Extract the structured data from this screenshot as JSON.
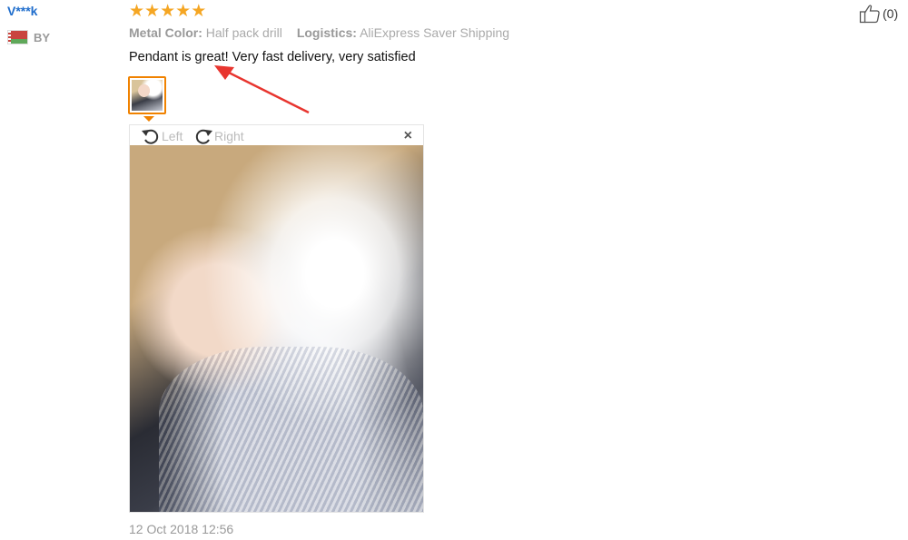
{
  "reviewer": {
    "name": "V***k",
    "country_code": "BY",
    "flag": "belarus-flag-icon"
  },
  "rating": {
    "stars": 5,
    "color": "#f5a623"
  },
  "attributes": {
    "metal_color_label": "Metal Color:",
    "metal_color_value": "Half pack drill",
    "logistics_label": "Logistics:",
    "logistics_value": "AliExpress Saver Shipping"
  },
  "review_text": "Pendant is great! Very fast delivery, very satisfied",
  "viewer": {
    "rotate_left_label": "Left",
    "rotate_right_label": "Right",
    "close_label": "×"
  },
  "timestamp": "12 Oct 2018 12:56",
  "helpful": {
    "count_text": "(0)"
  },
  "colors": {
    "accent_orange": "#f08200",
    "link_blue": "#1f6dcc",
    "arrow_red": "#e8352f"
  }
}
